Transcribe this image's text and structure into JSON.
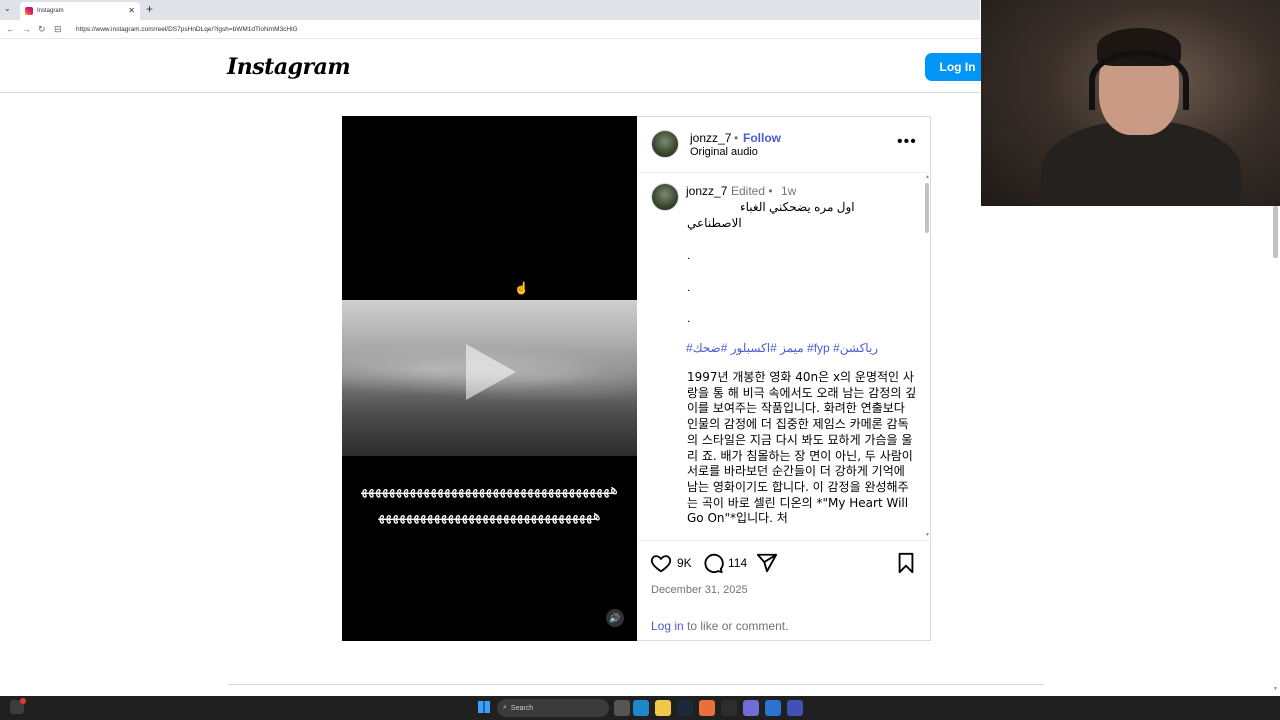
{
  "browser": {
    "tab_title": "Instagram",
    "url": "https://www.instagram.com/reel/DS7psHnDLqe/?igsh=bWM1dTloNmM3cHlG"
  },
  "header": {
    "logo_text": "Instagram",
    "login_label": "Log In"
  },
  "video": {
    "overlay_line1": "ﻫﻬﻬﻬﻬﻬﻬﻬﻬﻬﻬﻬﻬﻬﻬﻬﻬﻬﻬﻬﻬﻬﻬﻬﻬﻬﻬﻬﻬﻬﻬﻬﻬﻬﻬﻬﻬ",
    "overlay_line2": "ﻫﻬﻬﻬﻬﻬﻬﻬﻬﻬﻬﻬﻬﻬﻬﻬﻬﻬﻬﻬﻬﻬﻬﻬﻬﻬﻬﻬﻬﻬﻬﻬ"
  },
  "post": {
    "username": "jonzz_7",
    "dot": "•",
    "follow_label": "Follow",
    "audio": "Original audio",
    "caption": {
      "username": "jonzz_7",
      "edited": "Edited •",
      "time": "1w",
      "arabic_line1": "اول مره يضحكني الغباء",
      "arabic_line2": "الاصطناعي",
      "dots": [
        ".",
        ".",
        "."
      ],
      "hashtags": "#ميمز #اكسبلور #ضحك #fyp #رياكشن",
      "korean_text": "1997년 개봉한 영화 40n은 x의 운명적인 사랑을 통 해 비극 속에서도 오래 남는 감정의 깊이를 보여주는 작품입니다. 화려한 연출보다 인물의 감정에 더 집중한 제임스 카메론 감독의 스타일은 지금 다시 봐도 묘하게 가슴을 울리 죠. 배가 침몰하는 장 면이 아닌, 두 사람이 서로를 바라보던 순간들이 더 강하게 기억에 남는 영화이기도 합니다. 이 감정을 완성해주는 곡이 바로 셀린 디온의 *\"My Heart Will Go On\"*입니다. 처"
    },
    "likes": "9K",
    "comments": "114",
    "date": "December 31, 2025",
    "login_link": "Log in",
    "login_rest": " to like or comment."
  },
  "taskbar": {
    "search_placeholder": "Search"
  },
  "icons": [
    "heart-icon",
    "comment-icon",
    "share-icon",
    "bookmark-icon",
    "more-icon",
    "volume-icon",
    "play-icon"
  ],
  "colors": {
    "accent": "#4c5bd4",
    "login_button": "#0095f6",
    "muted_text": "#737373"
  }
}
